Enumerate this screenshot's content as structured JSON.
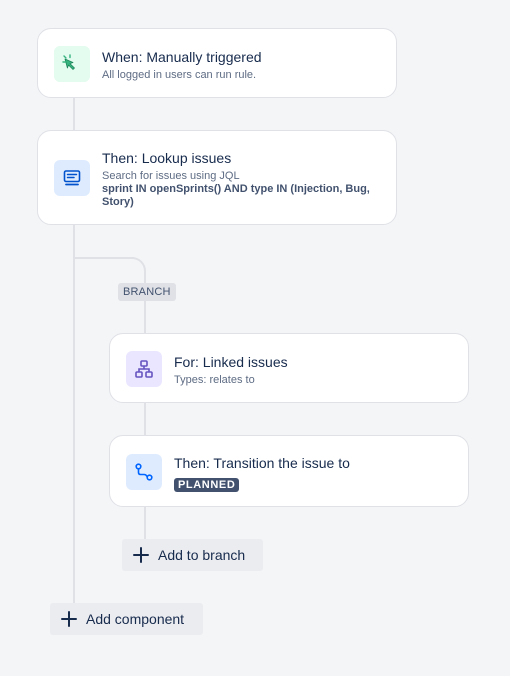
{
  "trigger": {
    "title": "When: Manually triggered",
    "subtitle": "All logged in users can run rule.",
    "icon": "cursor-click-icon",
    "icon_bg": "#e3fcef",
    "icon_color": "#36b37e"
  },
  "lookup": {
    "title": "Then: Lookup issues",
    "subtitle": "Search for issues using JQL",
    "jql": "sprint IN openSprints() AND type IN (Injection, Bug, Story)",
    "icon": "monitor-search-icon",
    "icon_bg": "#deebff",
    "icon_color": "#0052cc"
  },
  "branch": {
    "label": "BRANCH",
    "for_card": {
      "title": "For: Linked issues",
      "subtitle": "Types: relates to",
      "icon": "hierarchy-icon",
      "icon_bg": "#eae6ff",
      "icon_color": "#6554c0"
    },
    "transition_card": {
      "title": "Then: Transition the issue to",
      "status": "PLANNED",
      "icon": "transition-path-icon",
      "icon_bg": "#deebff",
      "icon_color": "#0065ff"
    },
    "add_button": "Add to branch"
  },
  "add_component_button": "Add component"
}
